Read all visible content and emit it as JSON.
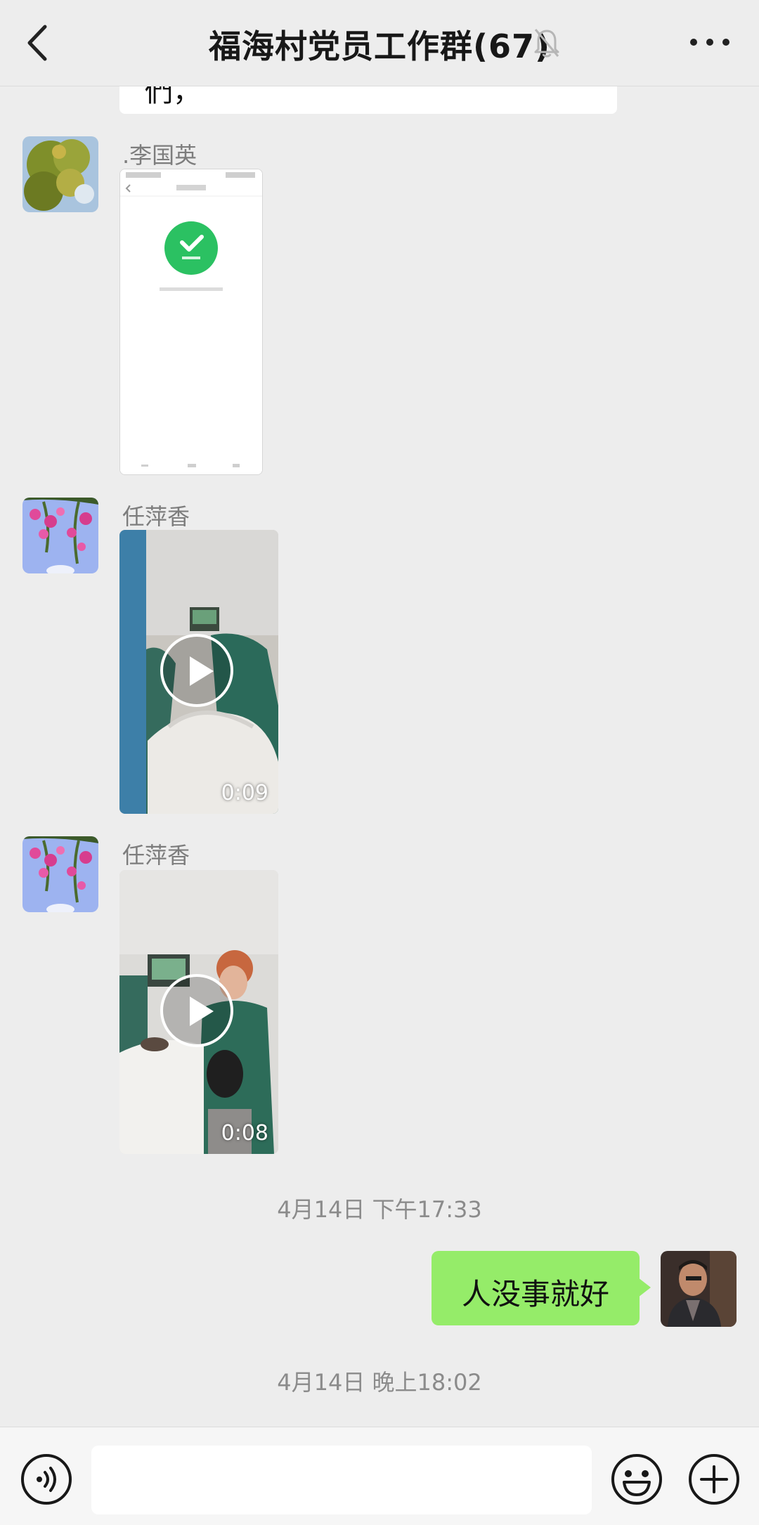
{
  "header": {
    "title": "福海村党员工作群(67)",
    "icons": {
      "back": "chevron-left-icon",
      "mute": "bell-muted-icon",
      "more": "ellipsis-icon"
    }
  },
  "messages": [
    {
      "type": "text-fragment",
      "text": "們，"
    },
    {
      "type": "image",
      "sender": ".李国英",
      "avatar": "tree-avatar",
      "screenshot_dot": "green-check"
    },
    {
      "type": "video",
      "sender": "任萍香",
      "avatar": "flower-avatar",
      "duration": "0:09"
    },
    {
      "type": "video",
      "sender": "任萍香",
      "avatar": "flower-avatar",
      "duration": "0:08"
    },
    {
      "type": "timestamp",
      "text": "4月14日 下午17:33"
    },
    {
      "type": "text",
      "from_me": true,
      "text": "人没事就好",
      "avatar": "man-avatar"
    },
    {
      "type": "timestamp",
      "text": "4月14日 晚上18:02"
    }
  ],
  "input_bar": {
    "value": "",
    "icons": [
      "voice-icon",
      "emoji-icon",
      "plus-icon"
    ]
  },
  "colors": {
    "background": "#ededed",
    "my_bubble": "#95ec69",
    "timestamp_text": "#8b8b8b"
  }
}
